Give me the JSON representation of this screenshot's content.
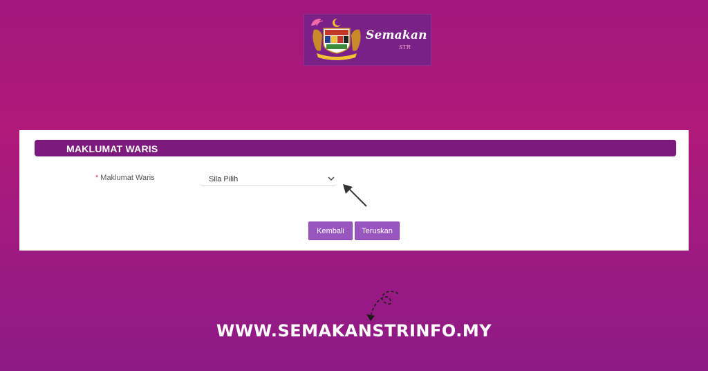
{
  "brand": {
    "logo_text": "Semakan",
    "logo_subtext": "STR",
    "emblem_icon": "malaysia-coat-of-arms-icon",
    "banner_color": "#7a2188"
  },
  "form": {
    "section_title": "MAKLUMAT WARIS",
    "field_required_mark": "*",
    "field_label": "Maklumat Waris",
    "select_value": "Sila Pilih",
    "buttons": {
      "back": "Kembali",
      "next": "Teruskan"
    },
    "colors": {
      "header": "#7d1a7d",
      "button": "#9a56c0"
    }
  },
  "footer": {
    "url": "WWW.SEMAKANSTRINFO.MY"
  },
  "background_color": "#a3177c"
}
